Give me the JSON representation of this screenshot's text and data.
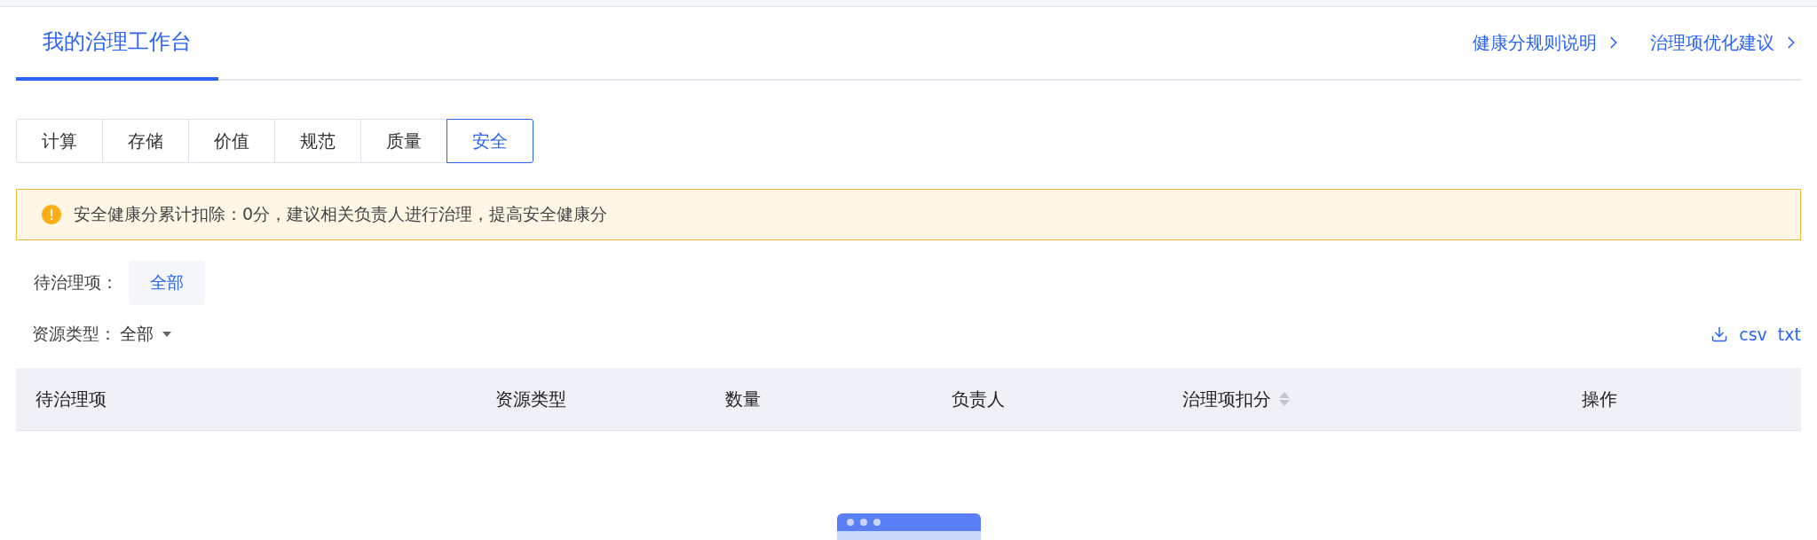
{
  "header": {
    "tabs": [
      {
        "label": "我的治理工作台",
        "selected": true
      }
    ],
    "links": [
      "健康分规则说明",
      "治理项优化建议"
    ]
  },
  "categories": [
    {
      "label": "计算",
      "selected": false
    },
    {
      "label": "存储",
      "selected": false
    },
    {
      "label": "价值",
      "selected": false
    },
    {
      "label": "规范",
      "selected": false
    },
    {
      "label": "质量",
      "selected": false
    },
    {
      "label": "安全",
      "selected": true
    }
  ],
  "alert": {
    "text": "安全健康分累计扣除：0分，建议相关负责人进行治理，提高安全健康分"
  },
  "filters": {
    "pending": {
      "label": "待治理项：",
      "options": [
        {
          "label": "全部",
          "selected": true
        }
      ]
    },
    "resource_type": {
      "label": "资源类型：",
      "value": "全部"
    }
  },
  "export": [
    "csv",
    "txt"
  ],
  "table": {
    "columns": [
      {
        "label": "待治理项",
        "sortable": false
      },
      {
        "label": "资源类型",
        "sortable": false
      },
      {
        "label": "数量",
        "sortable": false
      },
      {
        "label": "负责人",
        "sortable": false
      },
      {
        "label": "治理项扣分",
        "sortable": true
      },
      {
        "label": "操作",
        "sortable": false
      }
    ]
  }
}
